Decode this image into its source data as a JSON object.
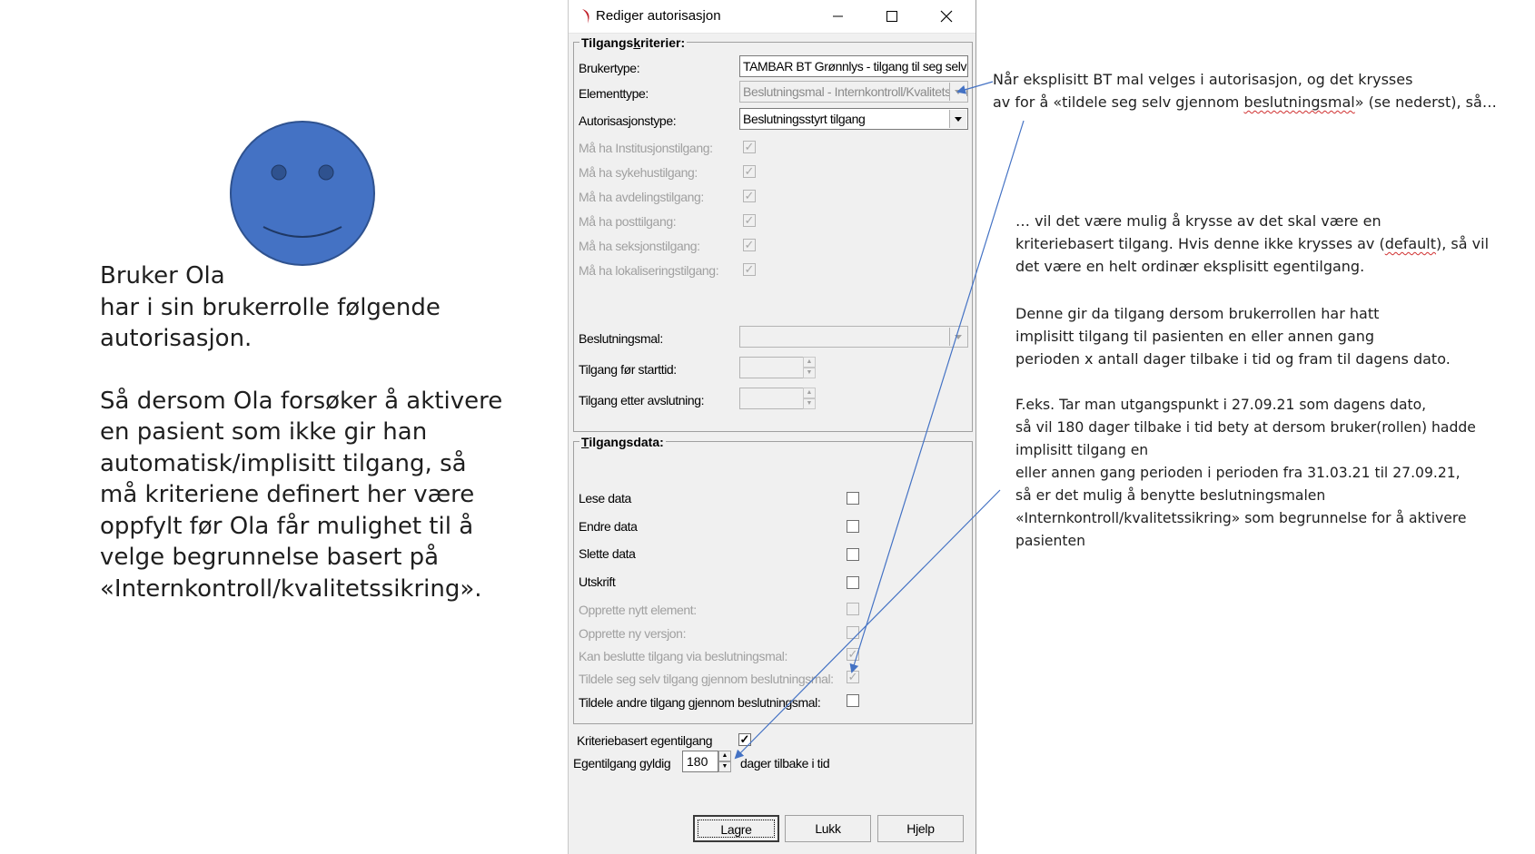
{
  "slide": {
    "left_paragraphs": [
      [
        "Bruker Ola",
        "har i sin brukerrolle følgende",
        "autorisasjon."
      ],
      [
        "Så dersom Ola forsøker å aktivere",
        "en pasient som ikke gir han",
        "automatisk/implisitt tilgang, så",
        "må kriteriene definert her være",
        "oppfylt før Ola får mulighet til å",
        "velge begrunnelse basert på",
        "«Internkontroll/kvalitetssikring»."
      ]
    ],
    "note1": {
      "line1": "Når eksplisitt BT mal velges i autorisasjon, og det krysses",
      "line2_pre": "av for å «tildele seg selv gjennom ",
      "line2_flag": "beslutningsmal",
      "line2_post": "» (se nederst), så…"
    },
    "note2": {
      "line1": "… vil det være mulig å krysse av det skal være en",
      "line2_pre": "kriteriebasert tilgang. Hvis denne ikke krysses av (",
      "line2_flag": "default",
      "line2_post": "), så vil",
      "line3": "det være en helt ordinær eksplisitt egentilgang."
    },
    "note3": {
      "lines": [
        "Denne gir da tilgang dersom brukerrollen har hatt",
        "implisitt tilgang til pasienten en eller annen gang",
        "perioden x antall dager tilbake i tid og fram til dagens dato."
      ]
    },
    "note4": {
      "lines": [
        "F.eks. Tar man utgangspunkt i 27.09.21 som dagens dato,",
        "så vil 180 dager tilbake i tid bety at dersom bruker(rollen) hadde",
        "implisitt tilgang en",
        "eller annen gang perioden i perioden fra 31.03.21 til 27.09.21,",
        "så er det mulig å benytte beslutningsmalen",
        "«Internkontroll/kvalitetssikring» som begrunnelse for å aktivere",
        "pasienten"
      ]
    }
  },
  "dialog": {
    "title": "Rediger autorisasjon",
    "criteria": {
      "group_title_pre": "Tilgangs",
      "group_title_ul": "k",
      "group_title_post": "riterier:",
      "brukertype_label": "Brukertype:",
      "brukertype_value": "TAMBAR BT Grønnlys - tilgang til seg selv",
      "elementtype_label": "Elementtype:",
      "elementtype_value": "Beslutningsmal - Internkontroll/Kvalitetssikring",
      "autorisasjonstype_label": "Autorisasjonstype:",
      "autorisasjonstype_value": "Beslutningsstyrt tilgang",
      "must_have": [
        {
          "label": "Må ha Institusjonstilgang:",
          "checked": true
        },
        {
          "label": "Må ha sykehustilgang:",
          "checked": true
        },
        {
          "label": "Må ha avdelingstilgang:",
          "checked": true
        },
        {
          "label": "Må ha posttilgang:",
          "checked": true
        },
        {
          "label": "Må ha seksjonstilgang:",
          "checked": true
        },
        {
          "label": "Må ha lokaliseringstilgang:",
          "checked": true
        }
      ],
      "beslutningsmal_label": "Beslutningsmal:",
      "beslutningsmal_value": "",
      "for_start_label": "Tilgang før starttid:",
      "etter_slutt_label": "Tilgang etter avslutning:"
    },
    "access_data": {
      "group_title_ul": "T",
      "group_title_post": "ilgangsdata:",
      "rows": [
        {
          "label": "Lese data",
          "checked": false,
          "disabled": false
        },
        {
          "label": "Endre data",
          "checked": false,
          "disabled": false
        },
        {
          "label": "Slette data",
          "checked": false,
          "disabled": false
        },
        {
          "label": "Utskrift",
          "checked": false,
          "disabled": false
        },
        {
          "label": "Opprette nytt element:",
          "checked": false,
          "disabled": true
        },
        {
          "label": "Opprette ny versjon:",
          "checked": false,
          "disabled": true
        },
        {
          "label": "Kan beslutte tilgang via beslutningsmal:",
          "checked": true,
          "disabled": true
        },
        {
          "label": "Tildele seg selv tilgang gjennom beslutningsmal:",
          "checked": true,
          "disabled": true
        },
        {
          "label": "Tildele andre tilgang gjennom beslutningsmal:",
          "checked": false,
          "disabled": false
        }
      ]
    },
    "egentilgang": {
      "kriteriebasert_label": "Kriteriebasert egentilgang",
      "kriteriebasert_checked": true,
      "gyldig_label": "Egentilgang gyldig",
      "gyldig_value": "180",
      "suffix": "dager tilbake i tid"
    },
    "buttons": {
      "lagre": "Lagre",
      "lukk": "Lukk",
      "hjelp": "Hjelp"
    },
    "check_glyph": "✓",
    "colors": {
      "smiley_fill": "#4472c4",
      "smiley_stroke": "#2f528f",
      "arrow": "#4472c4"
    }
  }
}
